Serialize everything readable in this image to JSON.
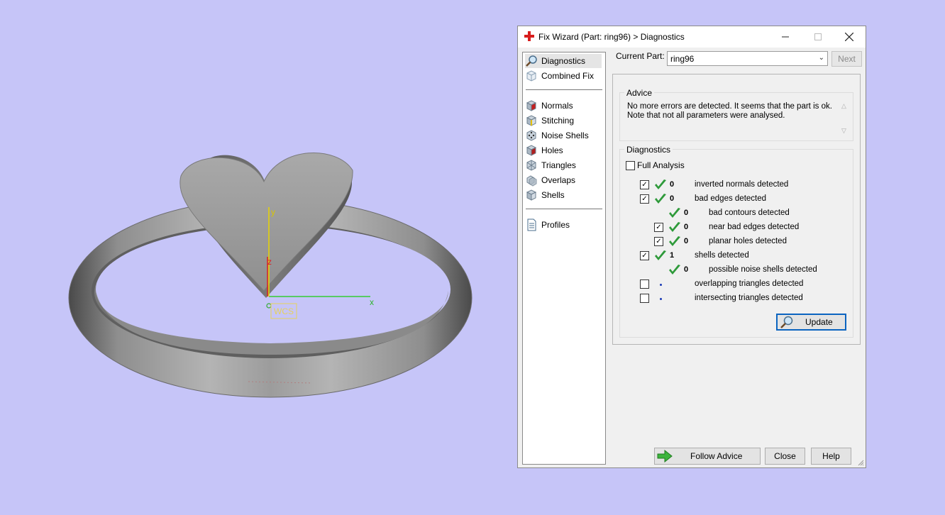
{
  "viewport": {
    "axis_x": "x",
    "axis_y": "y",
    "axis_z": "z",
    "wcs_label": "WCS"
  },
  "dialog": {
    "title": "Fix Wizard (Part: ring96) > Diagnostics",
    "sidebar": {
      "items": [
        {
          "label": "Diagnostics",
          "icon": "magnifier-icon",
          "selected": true
        },
        {
          "label": "Combined Fix",
          "icon": "cube-outline-icon"
        },
        {
          "label": "Normals",
          "icon": "cube-red-face-icon"
        },
        {
          "label": "Stitching",
          "icon": "cube-yellow-edge-icon"
        },
        {
          "label": "Noise Shells",
          "icon": "dotted-cube-icon"
        },
        {
          "label": "Holes",
          "icon": "cube-hole-icon"
        },
        {
          "label": "Triangles",
          "icon": "triangle-cube-icon"
        },
        {
          "label": "Overlaps",
          "icon": "overlap-cube-icon"
        },
        {
          "label": "Shells",
          "icon": "cube-icon"
        },
        {
          "label": "Profiles",
          "icon": "document-icon"
        }
      ]
    },
    "current_part_label": "Current Part:",
    "current_part_value": "ring96",
    "next_label": "Next",
    "advice": {
      "title": "Advice",
      "text": "No more errors are detected. It seems that the part is ok.\nNote that not all parameters were analysed."
    },
    "diagnostics": {
      "title": "Diagnostics",
      "full_analysis_label": "Full Analysis",
      "full_analysis_checked": false,
      "rows": [
        {
          "checked": true,
          "status": "ok",
          "count": "0",
          "label": "inverted normals detected"
        },
        {
          "checked": true,
          "status": "ok",
          "count": "0",
          "label": "bad edges detected"
        },
        {
          "checked": null,
          "status": "ok",
          "count": "0",
          "label": "bad contours detected"
        },
        {
          "checked": true,
          "status": "ok",
          "count": "0",
          "label": "near bad edges detected"
        },
        {
          "checked": true,
          "status": "ok",
          "count": "0",
          "label": "planar holes detected"
        },
        {
          "checked": true,
          "status": "ok",
          "count": "1",
          "label": "shells detected"
        },
        {
          "checked": null,
          "status": "ok",
          "count": "0",
          "label": "possible noise shells detected"
        },
        {
          "checked": false,
          "status": "not-run",
          "count": "",
          "label": "overlapping triangles detected"
        },
        {
          "checked": false,
          "status": "not-run",
          "count": "",
          "label": "intersecting triangles detected"
        }
      ],
      "update_label": "Update"
    },
    "follow_advice_label": "Follow Advice",
    "close_label": "Close",
    "help_label": "Help"
  },
  "colors": {
    "background": "#c6c5f8",
    "check_green": "#2e9a3a",
    "axis_x": "#33cc33",
    "axis_y": "#e8d400",
    "axis_z": "#dd2222"
  }
}
